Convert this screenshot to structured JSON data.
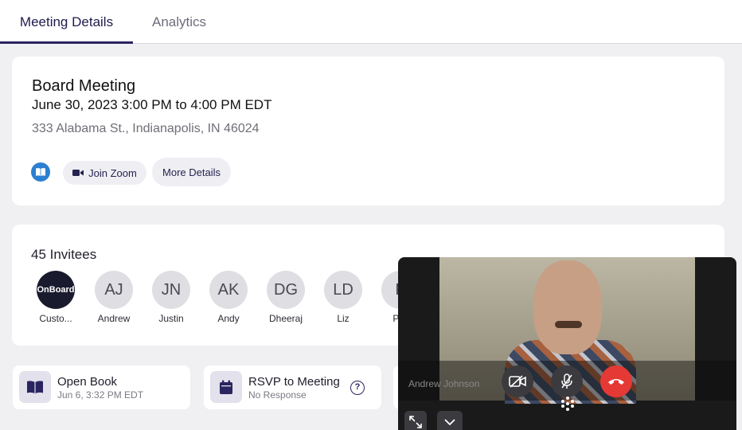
{
  "tabs": [
    {
      "label": "Meeting Details",
      "active": true
    },
    {
      "label": "Analytics",
      "active": false
    }
  ],
  "meeting": {
    "title": "Board Meeting",
    "datetime": "June 30, 2023 3:00 PM to 4:00 PM EDT",
    "address": "333 Alabama St., Indianapolis, IN 46024",
    "join_zoom_label": "Join Zoom",
    "more_details_label": "More Details"
  },
  "invitees": {
    "count_label": "45 Invitees",
    "items": [
      {
        "initials": "OnBoard",
        "name": "Custo..."
      },
      {
        "initials": "AJ",
        "name": "Andrew"
      },
      {
        "initials": "JN",
        "name": "Justin"
      },
      {
        "initials": "AK",
        "name": "Andy"
      },
      {
        "initials": "DG",
        "name": "Dheeraj"
      },
      {
        "initials": "LD",
        "name": "Liz"
      },
      {
        "initials": "P",
        "name": "PW"
      }
    ]
  },
  "actions": {
    "open_book": {
      "title": "Open Book",
      "subtitle": "Jun 6, 3:32 PM EDT"
    },
    "rsvp": {
      "title": "RSVP to Meeting",
      "subtitle": "No Response",
      "help": "?"
    }
  },
  "video_call": {
    "participant_name": "Andrew Johnson"
  },
  "colors": {
    "accent": "#2a2460",
    "end_call": "#e53935",
    "book_icon": "#2c7fd1"
  }
}
